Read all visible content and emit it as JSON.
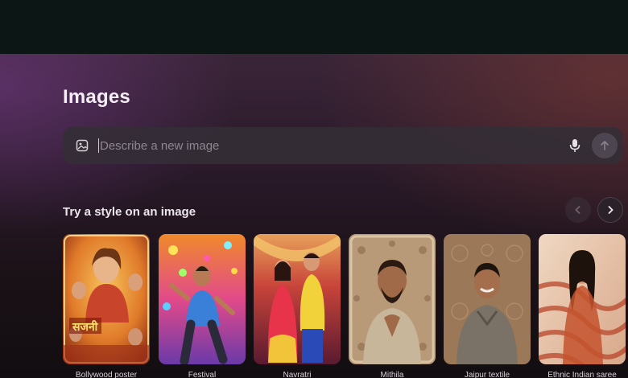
{
  "page": {
    "title": "Images"
  },
  "search": {
    "placeholder": "Describe a new image",
    "value": "",
    "image_icon": "add-image-icon",
    "mic_icon": "microphone-icon",
    "send_icon": "arrow-up-icon"
  },
  "styles_section": {
    "title": "Try a style on an image",
    "prev_icon": "chevron-left-icon",
    "next_icon": "chevron-right-icon",
    "cards": [
      {
        "label": "Bollywood poster",
        "poster_text": "सजनी"
      },
      {
        "label": "Festival"
      },
      {
        "label": "Navratri"
      },
      {
        "label": "Mithila"
      },
      {
        "label": "Jaipur textile"
      },
      {
        "label": "Ethnic Indian saree"
      }
    ]
  }
}
